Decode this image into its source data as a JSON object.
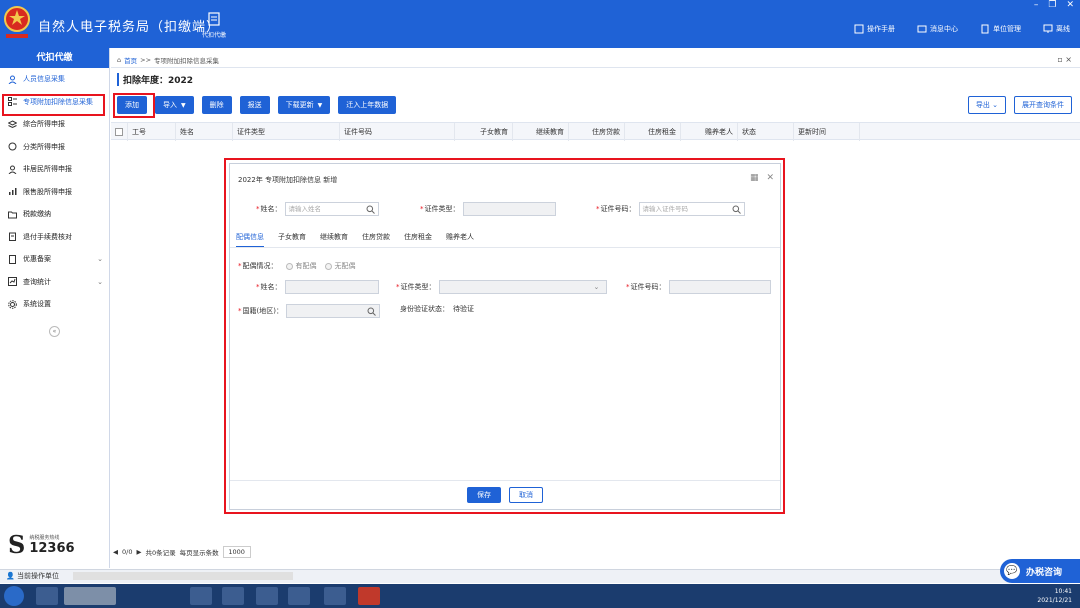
{
  "header": {
    "app_title": "自然人电子税务局（扣缴端）",
    "module_label": "代扣代缴",
    "links": [
      "操作手册",
      "消息中心",
      "单位管理",
      "离线"
    ]
  },
  "sidebar": {
    "title": "代扣代缴",
    "items": [
      {
        "label": "人员信息采集"
      },
      {
        "label": "专项附加扣除信息采集"
      },
      {
        "label": "综合所得申报"
      },
      {
        "label": "分类所得申报"
      },
      {
        "label": "非居民所得申报"
      },
      {
        "label": "限售股所得申报"
      },
      {
        "label": "税款缴纳"
      },
      {
        "label": "退付手续费核对"
      },
      {
        "label": "优惠备案"
      },
      {
        "label": "查询统计"
      },
      {
        "label": "系统设置"
      }
    ],
    "hotline_label": "纳税服务热线",
    "hotline_number": "12366"
  },
  "main": {
    "breadcrumb_home": "首页",
    "breadcrumb_sep": ">>",
    "breadcrumb_current": "专项附加扣除信息采集",
    "year_label": "扣除年度：2022",
    "toolbar": {
      "add": "添加",
      "import": "导入",
      "delete": "删除",
      "submit": "报送",
      "download": "下载更新",
      "migrate": "迁入上年数据",
      "export": "导出",
      "expand_query": "展开查询条件"
    },
    "columns": [
      "工号",
      "姓名",
      "证件类型",
      "证件号码",
      "子女教育",
      "继续教育",
      "住房贷款",
      "住房租金",
      "赡养老人",
      "状态",
      "更新时间"
    ],
    "pager": {
      "page_info": "0/0",
      "records": "共0条记录",
      "per_page_label": "每页显示条数",
      "per_page": "1000"
    }
  },
  "dialog": {
    "title": "2022年 专项附加扣除信息 新增",
    "name_label": "姓名：",
    "name_placeholder": "请输入姓名",
    "id_type_label": "证件类型：",
    "id_number_label": "证件号码：",
    "id_number_placeholder": "请输入证件号码",
    "tabs": [
      "配偶信息",
      "子女教育",
      "继续教育",
      "住房贷款",
      "住房租金",
      "赡养老人"
    ],
    "spouse_status_label": "配偶情况：",
    "radio_has": "有配偶",
    "radio_none": "无配偶",
    "spouse_name_label": "姓名：",
    "spouse_id_type_label": "证件类型：",
    "spouse_id_number_label": "证件号码：",
    "nationality_label": "国籍(地区)：",
    "verify_label": "身份验证状态：",
    "verify_value": "待验证",
    "save": "保存",
    "cancel": "取消"
  },
  "status": {
    "current_unit": "当前操作单位",
    "consult": "办税咨询"
  },
  "taskbar": {
    "time": "10:41",
    "date": "2021/12/21"
  },
  "colors": {
    "primary": "#1f62d6",
    "highlight": "#e8141e"
  }
}
